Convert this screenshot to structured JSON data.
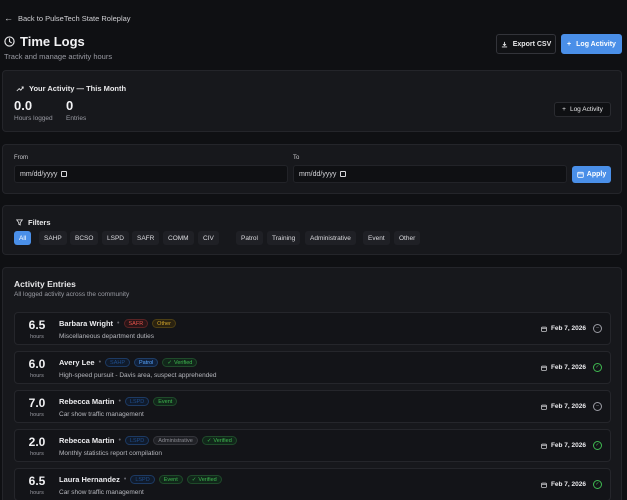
{
  "nav": {
    "back_label": "Back to PulseTech State Roleplay"
  },
  "header": {
    "title": "Time Logs",
    "subtitle": "Track and manage activity hours",
    "export_label": "Export CSV",
    "log_label": "Log Activity"
  },
  "activity": {
    "title": "Your Activity — This Month",
    "hours_value": "0.0",
    "hours_label": "Hours logged",
    "entries_value": "0",
    "entries_label": "Entries",
    "log_label": "Log Activity"
  },
  "dates": {
    "from_label": "From",
    "from_placeholder": "mm/dd/yyyy",
    "to_label": "To",
    "to_placeholder": "mm/dd/yyyy",
    "apply_label": "Apply"
  },
  "filters": {
    "title": "Filters",
    "departments": [
      "All",
      "SAHP",
      "BCSO",
      "LSPD",
      "SAFR",
      "COMM",
      "CIV"
    ],
    "types": [
      "Patrol",
      "Training",
      "Administrative",
      "Event",
      "Other"
    ],
    "active": "All"
  },
  "entries": {
    "title": "Activity Entries",
    "subtitle": "All logged activity across the community",
    "hours_unit": "hours",
    "items": [
      {
        "hours": "6.5",
        "name": "Barbara Wright",
        "dept": "SAFR",
        "type": "Other",
        "verified": "",
        "desc": "Miscellaneous department duties",
        "date": "Feb 7, 2026",
        "status": "pending"
      },
      {
        "hours": "6.0",
        "name": "Avery Lee",
        "dept": "SAHP",
        "type": "Patrol",
        "verified": "Verified",
        "desc": "High-speed pursuit - Davis area, suspect apprehended",
        "date": "Feb 7, 2026",
        "status": "verified"
      },
      {
        "hours": "7.0",
        "name": "Rebecca Martin",
        "dept": "LSPD",
        "type": "Event",
        "verified": "",
        "desc": "Car show traffic management",
        "date": "Feb 7, 2026",
        "status": "pending"
      },
      {
        "hours": "2.0",
        "name": "Rebecca Martin",
        "dept": "LSPD",
        "type": "Administrative",
        "verified": "Verified",
        "desc": "Monthly statistics report compilation",
        "date": "Feb 7, 2026",
        "status": "verified"
      },
      {
        "hours": "6.5",
        "name": "Laura Hernandez",
        "dept": "LSPD",
        "type": "Event",
        "verified": "Verified",
        "desc": "Car show traffic management",
        "date": "Feb 7, 2026",
        "status": "verified"
      }
    ]
  },
  "colors": {
    "accent": "#4a8fe8",
    "verified": "#3fb950",
    "safr": "#e5534b",
    "other": "#d4a72c",
    "patrol": "#58a6ff",
    "dept_blue": "#1f4e8c"
  }
}
